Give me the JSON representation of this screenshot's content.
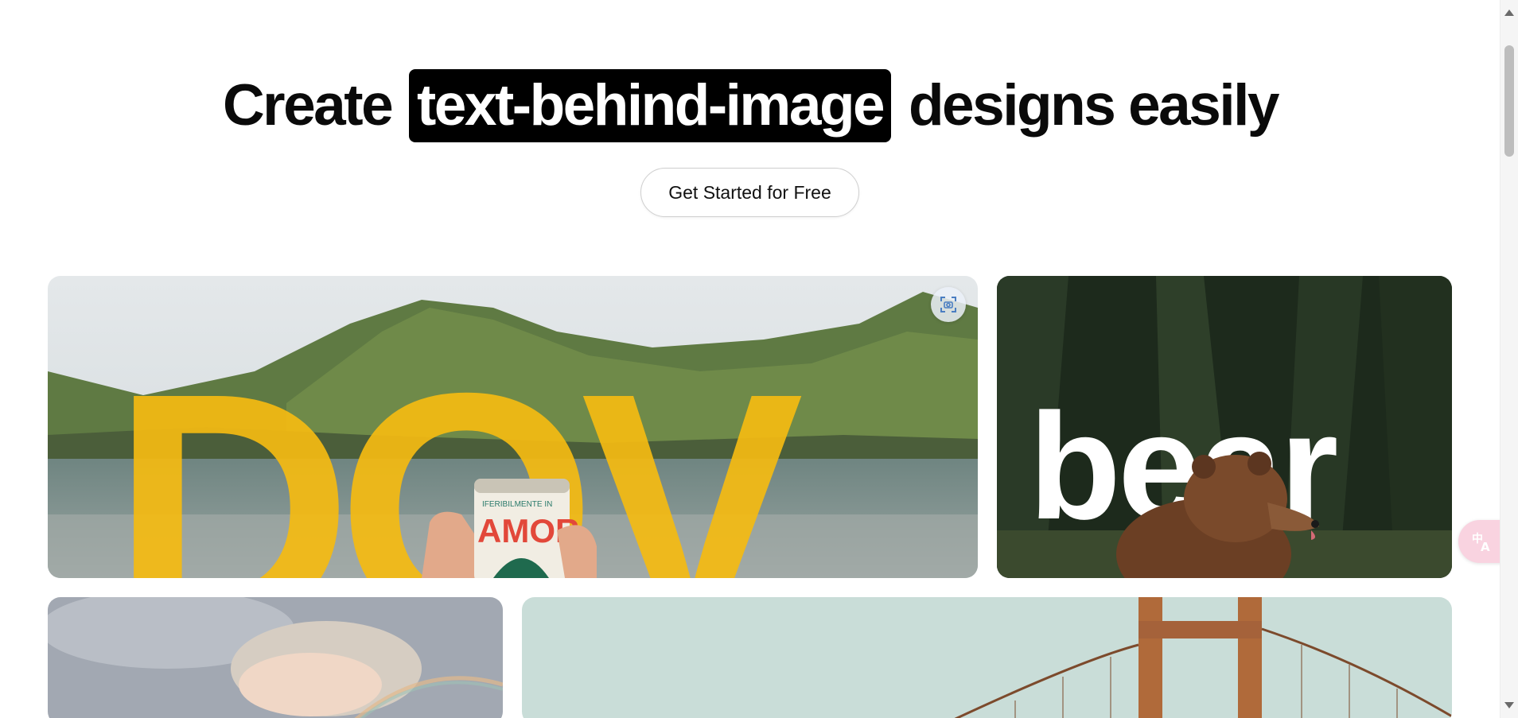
{
  "hero": {
    "title_before": "Create",
    "title_highlight": "text-behind-image",
    "title_after": "designs easily"
  },
  "cta": {
    "label": "Get Started for Free"
  },
  "gallery": {
    "card1": {
      "overlay_text": "DOV",
      "text_color": "#f5bb12",
      "can_text": "AMOR",
      "can_top_text": "IFERIBILMENTE IN"
    },
    "card2": {
      "overlay_text": "bear",
      "text_color": "#ffffff"
    },
    "card3": {
      "subject": "rainbow-clouds"
    },
    "card4": {
      "subject": "bridge-tower"
    }
  },
  "widgets": {
    "scan_icon": "scan-icon",
    "translate_icon": "translate-icon"
  },
  "colors": {
    "highlight_bg": "#000000",
    "highlight_text": "#ffffff",
    "translate_tab": "#f9d3e0"
  }
}
